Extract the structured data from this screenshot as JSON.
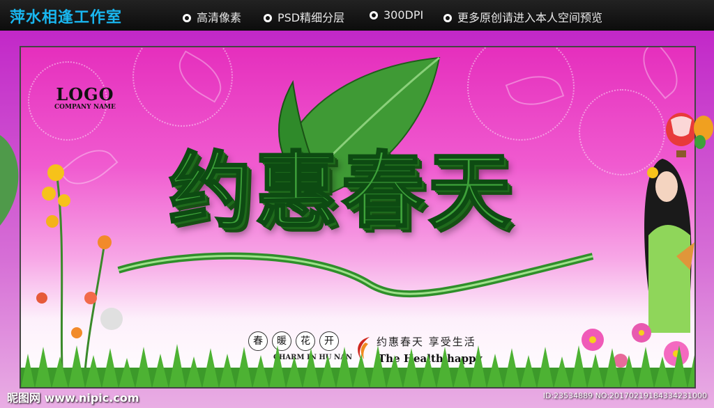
{
  "top_bar": {
    "studio_name": "萍水相逢工作室",
    "features": [
      "高清像素",
      "PSD精细分层",
      "300DPI",
      "更多原创请进入本人空间预览"
    ]
  },
  "poster": {
    "logo": {
      "main": "LOGO",
      "sub": "COMPANY NAME"
    },
    "headline": "约惠春天",
    "spring_chars": [
      "春",
      "暖",
      "花",
      "开"
    ],
    "charm_text": "CHARM IN HU NAN",
    "slogan_cn": "约惠春天 享受生活",
    "slogan_en": "The Health happy"
  },
  "watermark": {
    "site": "昵图网 www.nipic.com",
    "image_id": "ID:23534889 NO:20170219184334231000"
  },
  "colors": {
    "accent": "#19b6ef",
    "headline_green": "#3ea23a",
    "pink_bg": "#e52fbd"
  }
}
